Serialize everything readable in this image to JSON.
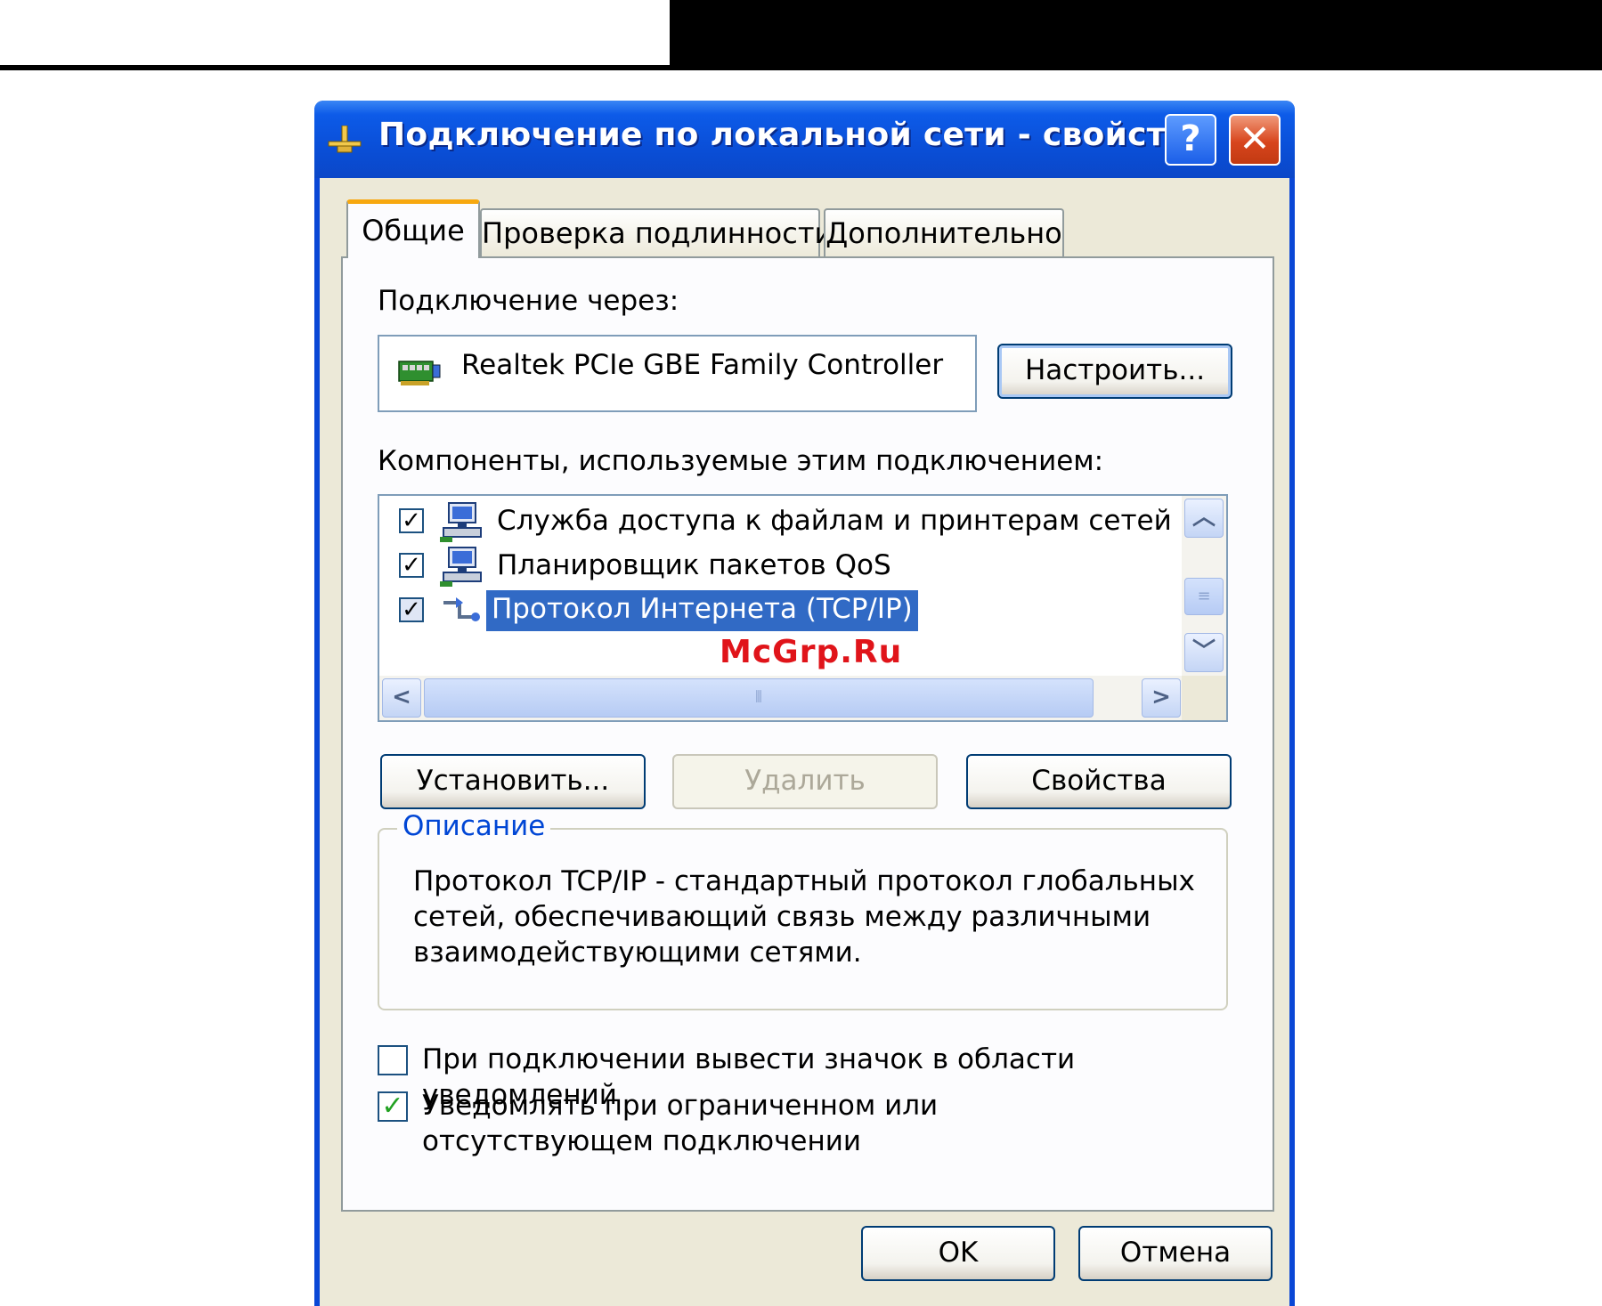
{
  "window": {
    "title": "Подключение по локальной сети - свойства",
    "help_label": "?",
    "close_label": "✕"
  },
  "tabs": [
    {
      "label": "Общие",
      "active": true
    },
    {
      "label": "Проверка подлинности",
      "active": false
    },
    {
      "label": "Дополнительно",
      "active": false
    }
  ],
  "general": {
    "connect_using_label": "Подключение через:",
    "adapter_name": "Realtek PCIe GBE Family Controller",
    "configure_button": "Настроить...",
    "components_label": "Компоненты, используемые этим подключением:",
    "components": [
      {
        "label": "Служба доступа к файлам и принтерам сетей Micro",
        "checked": true,
        "selected": false,
        "icon": "network-service-icon"
      },
      {
        "label": "Планировщик пакетов QoS",
        "checked": true,
        "selected": false,
        "icon": "network-service-icon"
      },
      {
        "label": "Протокол Интернета (TCP/IP)",
        "checked": true,
        "selected": true,
        "icon": "protocol-icon"
      }
    ],
    "install_button": "Установить...",
    "uninstall_button": "Удалить",
    "properties_button": "Свойства",
    "description_legend": "Описание",
    "description_text": "Протокол TCP/IP - стандартный протокол глобальных сетей, обеспечивающий связь между различными взаимодействующими сетями.",
    "show_icon_option": {
      "label": "При подключении вывести значок в области уведомлений",
      "checked": false
    },
    "notify_option": {
      "label": "Уведомлять при ограниченном или отсутствующем подключении",
      "checked": true
    }
  },
  "footer": {
    "ok_button": "OK",
    "cancel_button": "Отмена"
  },
  "watermark": "McGrp.Ru",
  "colors": {
    "titlebar": "#0a4fd8",
    "selection": "#316ac5",
    "active_tab_accent": "#f7a80f",
    "legend_text": "#0046d5",
    "checkmark_green": "#21a121",
    "watermark": "#e0141a"
  },
  "scroll": {
    "vertical_position": 0.5,
    "horizontal_position": 0.0
  }
}
